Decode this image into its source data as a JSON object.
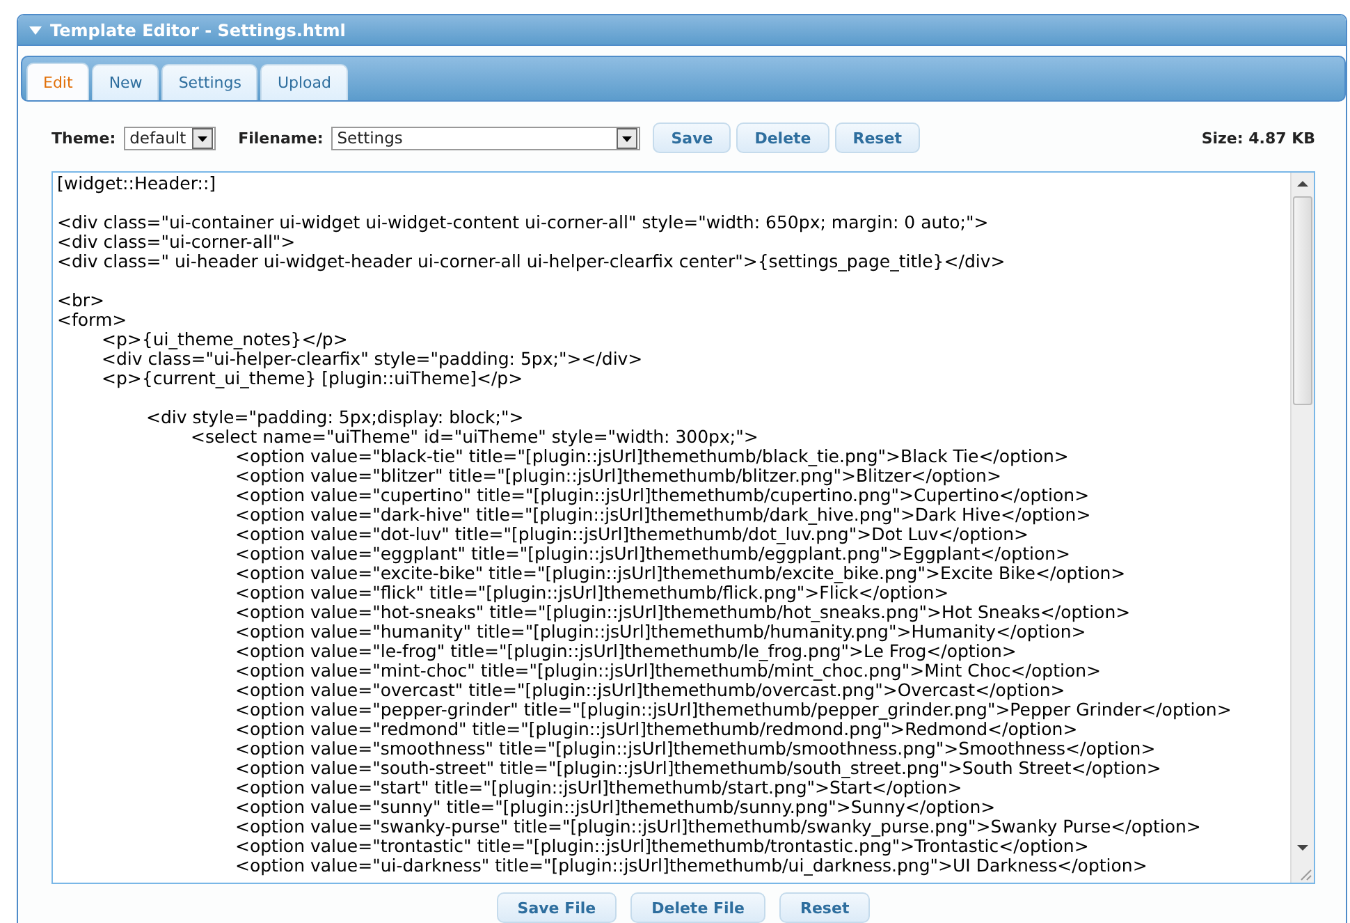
{
  "window": {
    "title": "Template Editor - Settings.html",
    "expanded": true
  },
  "tabs": [
    {
      "label": "Edit",
      "selected": true
    },
    {
      "label": "New",
      "selected": false
    },
    {
      "label": "Settings",
      "selected": false
    },
    {
      "label": "Upload",
      "selected": false
    }
  ],
  "toolbar": {
    "theme_label": "Theme:",
    "theme_value": "default",
    "filename_label": "Filename:",
    "filename_value": "Settings",
    "buttons": [
      "Save",
      "Delete",
      "Reset"
    ],
    "size": "Size: 4.87 KB"
  },
  "editor": {
    "content": "[widget::Header::]\n\n<div class=\"ui-container ui-widget ui-widget-content ui-corner-all\" style=\"width: 650px; margin: 0 auto;\">\n<div class=\"ui-corner-all\">\n<div class=\" ui-header ui-widget-header ui-corner-all ui-helper-clearfix center\">{settings_page_title}</div>\n\n<br>\n<form>\n\t<p>{ui_theme_notes}</p>\n\t<div class=\"ui-helper-clearfix\" style=\"padding: 5px;\"></div>\n\t<p>{current_ui_theme} [plugin::uiTheme]</p>\n\n\t\t<div style=\"padding: 5px;display: block;\">\n\t\t\t<select name=\"uiTheme\" id=\"uiTheme\" style=\"width: 300px;\">\n\t\t\t\t<option value=\"black-tie\" title=\"[plugin::jsUrl]themethumb/black_tie.png\">Black Tie</option>\n\t\t\t\t<option value=\"blitzer\" title=\"[plugin::jsUrl]themethumb/blitzer.png\">Blitzer</option>\n\t\t\t\t<option value=\"cupertino\" title=\"[plugin::jsUrl]themethumb/cupertino.png\">Cupertino</option>\n\t\t\t\t<option value=\"dark-hive\" title=\"[plugin::jsUrl]themethumb/dark_hive.png\">Dark Hive</option>\n\t\t\t\t<option value=\"dot-luv\" title=\"[plugin::jsUrl]themethumb/dot_luv.png\">Dot Luv</option>\n\t\t\t\t<option value=\"eggplant\" title=\"[plugin::jsUrl]themethumb/eggplant.png\">Eggplant</option>\n\t\t\t\t<option value=\"excite-bike\" title=\"[plugin::jsUrl]themethumb/excite_bike.png\">Excite Bike</option>\n\t\t\t\t<option value=\"flick\" title=\"[plugin::jsUrl]themethumb/flick.png\">Flick</option>\n\t\t\t\t<option value=\"hot-sneaks\" title=\"[plugin::jsUrl]themethumb/hot_sneaks.png\">Hot Sneaks</option>\n\t\t\t\t<option value=\"humanity\" title=\"[plugin::jsUrl]themethumb/humanity.png\">Humanity</option>\n\t\t\t\t<option value=\"le-frog\" title=\"[plugin::jsUrl]themethumb/le_frog.png\">Le Frog</option>\n\t\t\t\t<option value=\"mint-choc\" title=\"[plugin::jsUrl]themethumb/mint_choc.png\">Mint Choc</option>\n\t\t\t\t<option value=\"overcast\" title=\"[plugin::jsUrl]themethumb/overcast.png\">Overcast</option>\n\t\t\t\t<option value=\"pepper-grinder\" title=\"[plugin::jsUrl]themethumb/pepper_grinder.png\">Pepper Grinder</option>\n\t\t\t\t<option value=\"redmond\" title=\"[plugin::jsUrl]themethumb/redmond.png\">Redmond</option>\n\t\t\t\t<option value=\"smoothness\" title=\"[plugin::jsUrl]themethumb/smoothness.png\">Smoothness</option>\n\t\t\t\t<option value=\"south-street\" title=\"[plugin::jsUrl]themethumb/south_street.png\">South Street</option>\n\t\t\t\t<option value=\"start\" title=\"[plugin::jsUrl]themethumb/start.png\">Start</option>\n\t\t\t\t<option value=\"sunny\" title=\"[plugin::jsUrl]themethumb/sunny.png\">Sunny</option>\n\t\t\t\t<option value=\"swanky-purse\" title=\"[plugin::jsUrl]themethumb/swanky_purse.png\">Swanky Purse</option>\n\t\t\t\t<option value=\"trontastic\" title=\"[plugin::jsUrl]themethumb/trontastic.png\">Trontastic</option>\n\t\t\t\t<option value=\"ui-darkness\" title=\"[plugin::jsUrl]themethumb/ui_darkness.png\">UI Darkness</option>"
  },
  "footer_buttons": [
    "Save File",
    "Delete File",
    "Reset"
  ]
}
